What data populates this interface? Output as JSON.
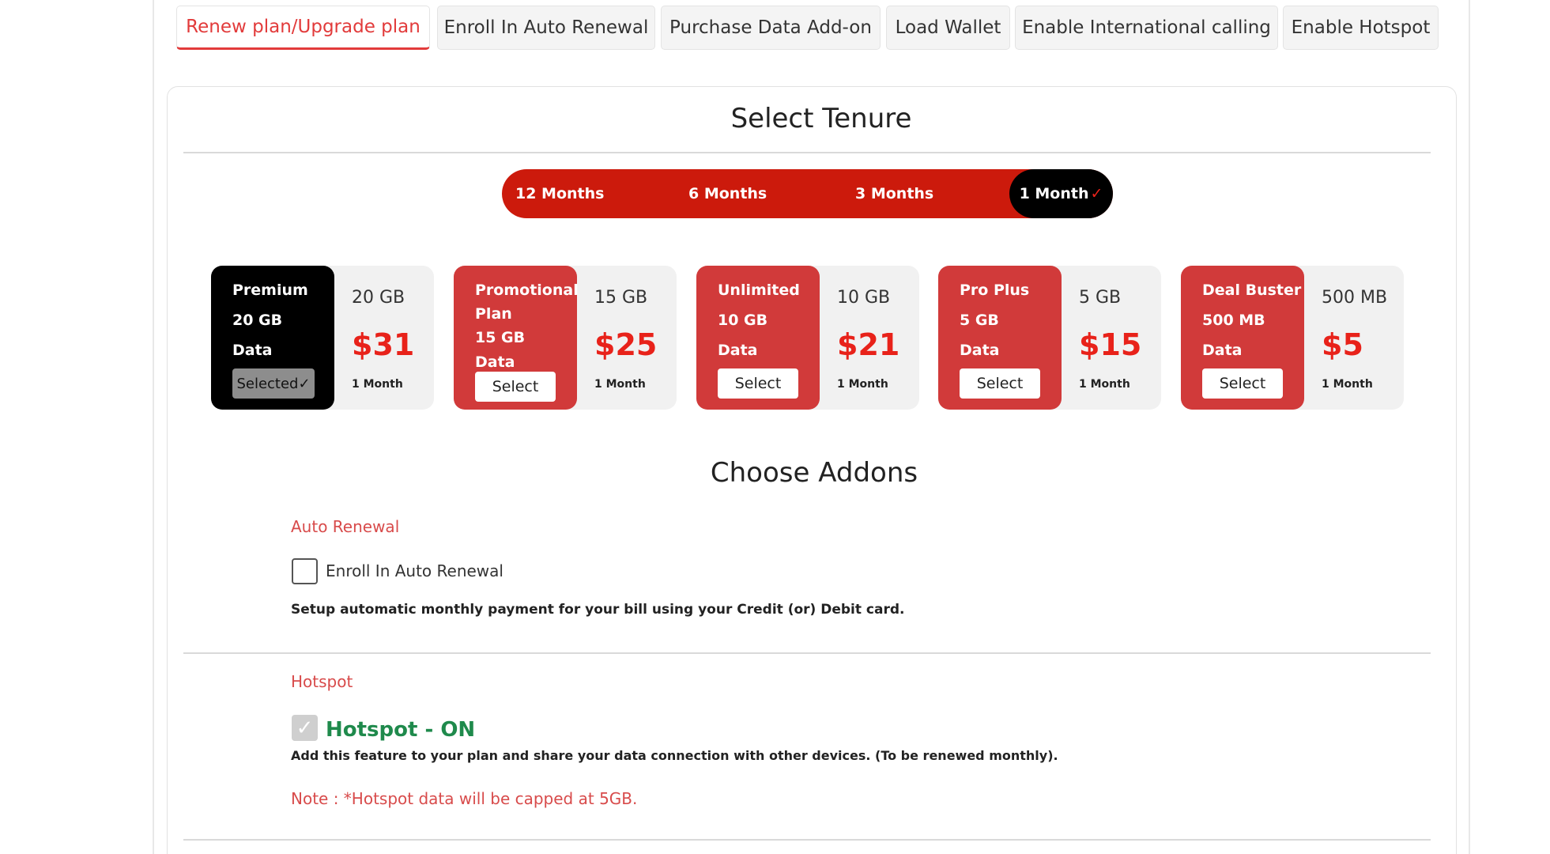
{
  "tabs": [
    {
      "label": "Renew plan/Upgrade plan",
      "active": true
    },
    {
      "label": "Enroll In Auto Renewal"
    },
    {
      "label": "Purchase Data Add-on"
    },
    {
      "label": "Load Wallet"
    },
    {
      "label": "Enable International calling"
    },
    {
      "label": "Enable Hotspot"
    }
  ],
  "tenure": {
    "title": "Select Tenure",
    "options": [
      "12 Months",
      "6 Months",
      "3 Months",
      "1 Month"
    ],
    "selected": "1 Month",
    "selected_mark": "✓"
  },
  "plans": [
    {
      "name": "Premium",
      "gb": "20 GB",
      "data_label": "Data",
      "button": "Selected✓",
      "size": "20 GB",
      "price": "$31",
      "tenure": "1 Month",
      "selected": true
    },
    {
      "name": "Promotional Plan",
      "gb": "15 GB",
      "data_label": "Data",
      "button": "Select",
      "size": "15 GB",
      "price": "$25",
      "tenure": "1 Month"
    },
    {
      "name": "Unlimited",
      "gb": "10 GB",
      "data_label": "Data",
      "button": "Select",
      "size": "10 GB",
      "price": "$21",
      "tenure": "1 Month"
    },
    {
      "name": "Pro Plus",
      "gb": "5 GB",
      "data_label": "Data",
      "button": "Select",
      "size": "5 GB",
      "price": "$15",
      "tenure": "1 Month"
    },
    {
      "name": "Deal Buster",
      "gb": "500 MB",
      "data_label": "Data",
      "button": "Select",
      "size": "500 MB",
      "price": "$5",
      "tenure": "1 Month"
    }
  ],
  "addons": {
    "title": "Choose Addons",
    "auto_renewal": {
      "label": "Auto Renewal",
      "checkbox_label": "Enroll In Auto Renewal",
      "checked": false,
      "description": "Setup automatic monthly payment for your bill using your Credit (or) Debit card."
    },
    "hotspot": {
      "label": "Hotspot",
      "checkbox_mark": "✓",
      "status": "Hotspot - ON",
      "description": "Add this feature to your plan and share your data connection with other devices. (To be renewed monthly).",
      "note": "Note : *Hotspot data will be capped at 5GB."
    }
  },
  "colors": {
    "accent_red": "#e8221a",
    "plan_red": "#d13a3a",
    "tenure_red": "#cc1a0c",
    "hotspot_green": "#1f8a4c"
  }
}
